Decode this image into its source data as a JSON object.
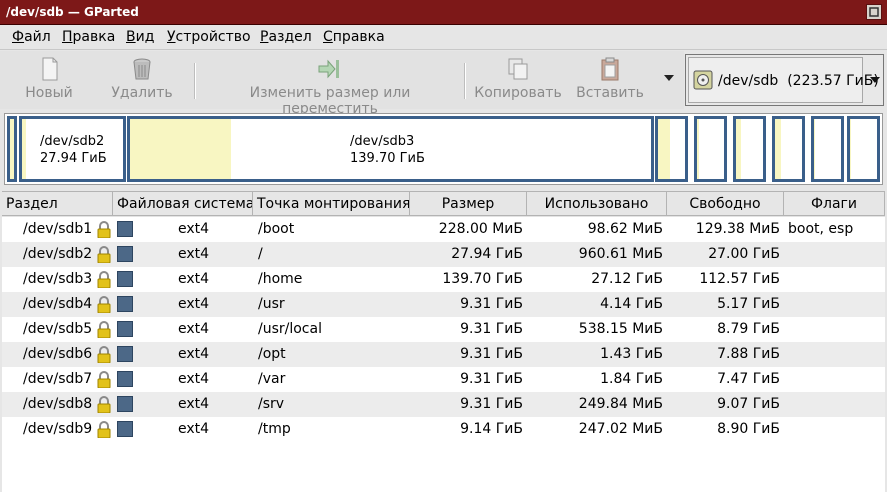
{
  "window": {
    "title": "/dev/sdb — GParted"
  },
  "menu": [
    {
      "label": "Файл",
      "u": "Ф",
      "rest": "айл"
    },
    {
      "label": "Правка",
      "u": "П",
      "rest": "равка"
    },
    {
      "label": "Вид",
      "u": "В",
      "rest": "ид"
    },
    {
      "label": "Устройство",
      "u": "У",
      "rest": "стройство"
    },
    {
      "label": "Раздел",
      "u": "Р",
      "rest": "аздел"
    },
    {
      "label": "Справка",
      "u": "С",
      "rest": "правка"
    }
  ],
  "toolbar": {
    "new_label": "Новый",
    "delete_label": "Удалить",
    "resize_label": "Изменить размер или переместить",
    "copy_label": "Копировать",
    "paste_label": "Вставить"
  },
  "device": {
    "name": "/dev/sdb",
    "size": "(223.57 ГиБ)"
  },
  "map": {
    "sdb2": {
      "name": "/dev/sdb2",
      "size": "27.94 ГиБ"
    },
    "sdb3": {
      "name": "/dev/sdb3",
      "size": "139.70 ГиБ"
    }
  },
  "columns": [
    "Раздел",
    "Файловая система",
    "Точка монтирования",
    "Размер",
    "Использовано",
    "Свободно",
    "Флаги"
  ],
  "rows": [
    {
      "partition": "/dev/sdb1",
      "fs": "ext4",
      "mount": "/boot",
      "size": "228.00 МиБ",
      "used": "98.62 МиБ",
      "free": "129.38 МиБ",
      "flags": "boot, esp"
    },
    {
      "partition": "/dev/sdb2",
      "fs": "ext4",
      "mount": "/",
      "size": "27.94 ГиБ",
      "used": "960.61 МиБ",
      "free": "27.00 ГиБ",
      "flags": ""
    },
    {
      "partition": "/dev/sdb3",
      "fs": "ext4",
      "mount": "/home",
      "size": "139.70 ГиБ",
      "used": "27.12 ГиБ",
      "free": "112.57 ГиБ",
      "flags": ""
    },
    {
      "partition": "/dev/sdb4",
      "fs": "ext4",
      "mount": "/usr",
      "size": "9.31 ГиБ",
      "used": "4.14 ГиБ",
      "free": "5.17 ГиБ",
      "flags": ""
    },
    {
      "partition": "/dev/sdb5",
      "fs": "ext4",
      "mount": "/usr/local",
      "size": "9.31 ГиБ",
      "used": "538.15 МиБ",
      "free": "8.79 ГиБ",
      "flags": ""
    },
    {
      "partition": "/dev/sdb6",
      "fs": "ext4",
      "mount": "/opt",
      "size": "9.31 ГиБ",
      "used": "1.43 ГиБ",
      "free": "7.88 ГиБ",
      "flags": ""
    },
    {
      "partition": "/dev/sdb7",
      "fs": "ext4",
      "mount": "/var",
      "size": "9.31 ГиБ",
      "used": "1.84 ГиБ",
      "free": "7.47 ГиБ",
      "flags": ""
    },
    {
      "partition": "/dev/sdb8",
      "fs": "ext4",
      "mount": "/srv",
      "size": "9.31 ГиБ",
      "used": "249.84 МиБ",
      "free": "9.07 ГиБ",
      "flags": ""
    },
    {
      "partition": "/dev/sdb9",
      "fs": "ext4",
      "mount": "/tmp",
      "size": "9.14 ГиБ",
      "used": "247.02 МиБ",
      "free": "8.90 ГиБ",
      "flags": ""
    }
  ],
  "colors": {
    "titlebar": "#7d1818",
    "partition_border": "#3a5f8a",
    "used_fill": "#f8f6c2",
    "fs_ext4": "#4c6887",
    "lock": "#e2c21a"
  }
}
